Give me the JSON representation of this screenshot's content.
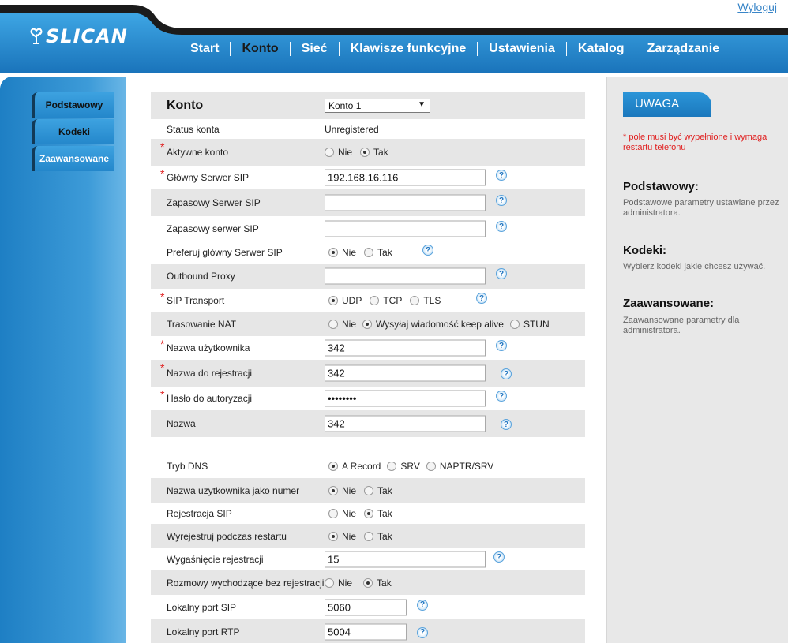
{
  "header": {
    "logout": "Wyloguj",
    "logo": "SLICAN",
    "nav": [
      "Start",
      "Konto",
      "Sieć",
      "Klawisze funkcyjne",
      "Ustawienia",
      "Katalog",
      "Zarządzanie"
    ],
    "active_nav": "Konto"
  },
  "sidebar": {
    "items": [
      "Podstawowy",
      "Kodeki",
      "Zaawansowane"
    ],
    "active": "Zaawansowane"
  },
  "form": {
    "account_label": "Konto",
    "account_select": "Konto 1",
    "status_label": "Status konta",
    "status_value": "Unregistered",
    "active_label": "Aktywne konto",
    "main_sip_label": "Główny Serwer SIP",
    "main_sip_value": "192.168.16.116",
    "backup_sip_label": "Zapasowy Serwer SIP",
    "backup_sip_value": "",
    "backup_sip2_label": "Zapasowy serwer SIP",
    "backup_sip2_value": "",
    "prefer_main_label": "Preferuj główny Serwer SIP",
    "outbound_label": "Outbound Proxy",
    "outbound_value": "",
    "transport_label": "SIP Transport",
    "nat_label": "Trasowanie NAT",
    "username_label": "Nazwa użytkownika",
    "username_value": "342",
    "register_name_label": "Nazwa do rejestracji",
    "register_name_value": "342",
    "password_label": "Hasło do autoryzacji",
    "password_value": "••••••••",
    "name_label": "Nazwa",
    "name_value": "342",
    "dns_label": "Tryb DNS",
    "user_as_number_label": "Nazwa uzytkownika jako numer",
    "sip_registration_label": "Rejestracja SIP",
    "unregister_restart_label": "Wyrejestruj podczas restartu",
    "expiry_label": "Wygaśnięcie rejestracji",
    "expiry_value": "15",
    "outgoing_label": "Rozmowy wychodzące bez rejestracji",
    "local_sip_port_label": "Lokalny port SIP",
    "local_sip_port_value": "5060",
    "local_rtp_port_label": "Lokalny port RTP",
    "local_rtp_port_value": "5004",
    "opt_no": "Nie",
    "opt_yes": "Tak",
    "opt_udp": "UDP",
    "opt_tcp": "TCP",
    "opt_tls": "TLS",
    "opt_keepalive": "Wysyłaj wiadomość keep alive",
    "opt_stun": "STUN",
    "opt_arecord": "A Record",
    "opt_srv": "SRV",
    "opt_naptr": "NAPTR/SRV",
    "help_glyph": "?"
  },
  "right_panel": {
    "uwaga": "UWAGA",
    "note": "* pole musi być wypełnione i wymaga restartu telefonu",
    "sections": [
      {
        "title": "Podstawowy:",
        "desc": "Podstawowe parametry ustawiane przez administratora."
      },
      {
        "title": "Kodeki:",
        "desc": "Wybierz kodeki jakie chcesz używać."
      },
      {
        "title": "Zaawansowane:",
        "desc": "Zaawansowane parametry dla administratora."
      }
    ]
  },
  "colors": {
    "brand_blue": "#1f86cc",
    "dark": "#1a1a1a",
    "required": "#e02020"
  }
}
